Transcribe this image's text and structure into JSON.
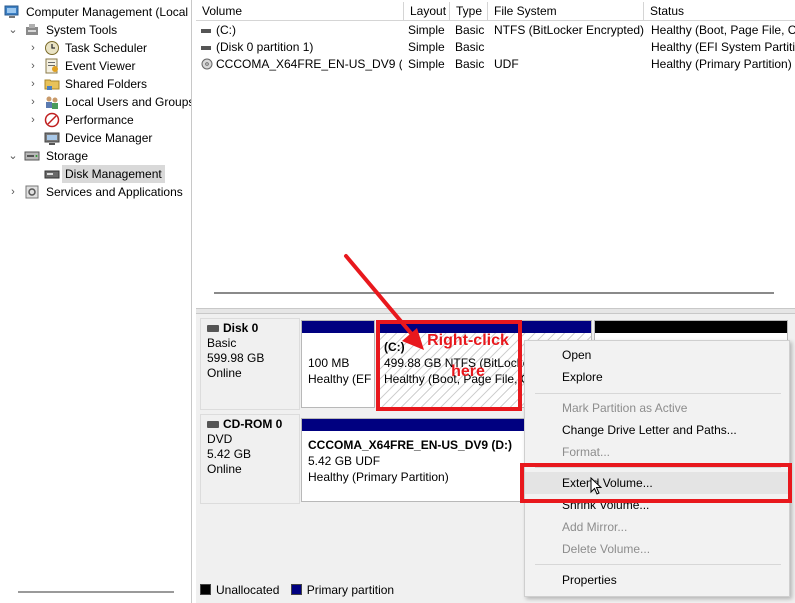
{
  "tree": {
    "items": [
      {
        "label": "Computer Management (Local",
        "icon": "computer-management-icon",
        "chevron": ""
      },
      {
        "label": "System Tools",
        "icon": "system-tools-icon",
        "chevron": "expanded"
      },
      {
        "label": "Task Scheduler",
        "icon": "task-scheduler-icon",
        "chevron": "collapsed"
      },
      {
        "label": "Event Viewer",
        "icon": "event-viewer-icon",
        "chevron": "collapsed"
      },
      {
        "label": "Shared Folders",
        "icon": "shared-folders-icon",
        "chevron": "collapsed"
      },
      {
        "label": "Local Users and Groups",
        "icon": "users-groups-icon",
        "chevron": "collapsed"
      },
      {
        "label": "Performance",
        "icon": "performance-icon",
        "chevron": "collapsed"
      },
      {
        "label": "Device Manager",
        "icon": "device-manager-icon",
        "chevron": ""
      },
      {
        "label": "Storage",
        "icon": "storage-icon",
        "chevron": "expanded"
      },
      {
        "label": "Disk Management",
        "icon": "disk-management-icon",
        "chevron": "",
        "selected": true
      },
      {
        "label": "Services and Applications",
        "icon": "services-icon",
        "chevron": "collapsed"
      }
    ]
  },
  "volumes": {
    "columns": [
      "Volume",
      "Layout",
      "Type",
      "File System",
      "Status"
    ],
    "rows": [
      {
        "volume": "(C:)",
        "layout": "Simple",
        "type": "Basic",
        "fs": "NTFS (BitLocker Encrypted)",
        "status": "Healthy (Boot, Page File, Cr",
        "icon": "drive-icon"
      },
      {
        "volume": "(Disk 0 partition 1)",
        "layout": "Simple",
        "type": "Basic",
        "fs": "",
        "status": "Healthy (EFI System Partiti",
        "icon": "drive-icon"
      },
      {
        "volume": "CCCOMA_X64FRE_EN-US_DV9 (D:)",
        "layout": "Simple",
        "type": "Basic",
        "fs": "UDF",
        "status": "Healthy (Primary Partition)",
        "icon": "cdrom-icon"
      }
    ]
  },
  "disks": [
    {
      "name": "Disk 0",
      "kind": "Basic",
      "size": "599.98 GB",
      "state": "Online",
      "partitions": [
        {
          "line1": "100 MB",
          "line2": "Healthy (EF",
          "line3": ""
        },
        {
          "line1": "(C:)",
          "line2": "499.88 GB NTFS (BitLocker",
          "line3": "Healthy (Boot, Page File, C"
        },
        {
          "line1": "",
          "line2": "",
          "line3": ""
        }
      ]
    },
    {
      "name": "CD-ROM 0",
      "kind": "DVD",
      "size": "5.42 GB",
      "state": "Online",
      "partitions": [
        {
          "line1": "CCCOMA_X64FRE_EN-US_DV9  (D:)",
          "line2": "5.42 GB UDF",
          "line3": "Healthy (Primary Partition)"
        }
      ]
    }
  ],
  "legend": {
    "unallocated": "Unallocated",
    "primary": "Primary partition"
  },
  "menu": {
    "items": [
      {
        "label": "Open",
        "disabled": false
      },
      {
        "label": "Explore",
        "disabled": false
      },
      {
        "label": "Mark Partition as Active",
        "disabled": true
      },
      {
        "label": "Change Drive Letter and Paths...",
        "disabled": false
      },
      {
        "label": "Format...",
        "disabled": true
      },
      {
        "label": "Extend Volume...",
        "disabled": false
      },
      {
        "label": "Shrink Volume...",
        "disabled": false
      },
      {
        "label": "Add Mirror...",
        "disabled": true
      },
      {
        "label": "Delete Volume...",
        "disabled": true
      },
      {
        "label": "Properties",
        "disabled": false
      }
    ]
  },
  "annotation": {
    "line1": "Right-click",
    "line2": "here"
  },
  "colors": {
    "primary_partition": "#000080",
    "unallocated": "#000000",
    "annotation": "#e8181d",
    "selection": "#d9d9d9"
  }
}
